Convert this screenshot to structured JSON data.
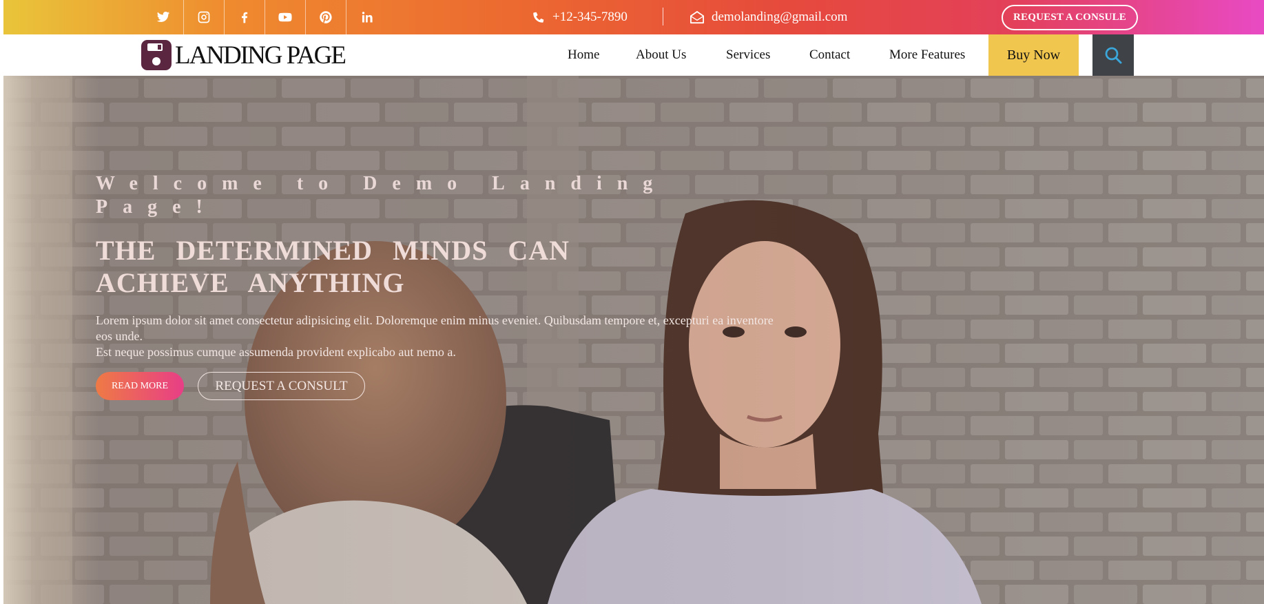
{
  "topbar": {
    "social_icons": [
      "twitter-icon",
      "instagram-icon",
      "facebook-icon",
      "youtube-icon",
      "pinterest-icon",
      "linkedin-icon"
    ],
    "phone": "+12-345-7890",
    "email": "demolanding@gmail.com",
    "consult_label": "REQUEST A CONSULE",
    "gradient": [
      "#e9c53a",
      "#ec6a30",
      "#e3405a",
      "#e84ac4"
    ]
  },
  "navbar": {
    "logo_text": "LANDING PAGE",
    "logo_color": "#5a2640",
    "items": [
      "Home",
      "About Us",
      "Services",
      "Contact",
      "More Features"
    ],
    "buy_now": "Buy Now",
    "buy_now_color": "#f0c64e",
    "search_icon": "search-icon"
  },
  "hero": {
    "welcome": "Welcome to Demo Landing Page!",
    "headline": "THE DETERMINED MINDS CAN ACHIEVE ANYTHING",
    "lorem_line1": "Lorem ipsum dolor sit amet consectetur adipisicing elit. Doloremque enim minus eveniet. Quibusdam tempore et, excepturi ea inventore eos unde.",
    "lorem_line2": "Est neque possimus cumque assumenda provident explicabo aut nemo a.",
    "read_more": "READ MORE",
    "request_consult": "REQUEST A CONSULT"
  }
}
